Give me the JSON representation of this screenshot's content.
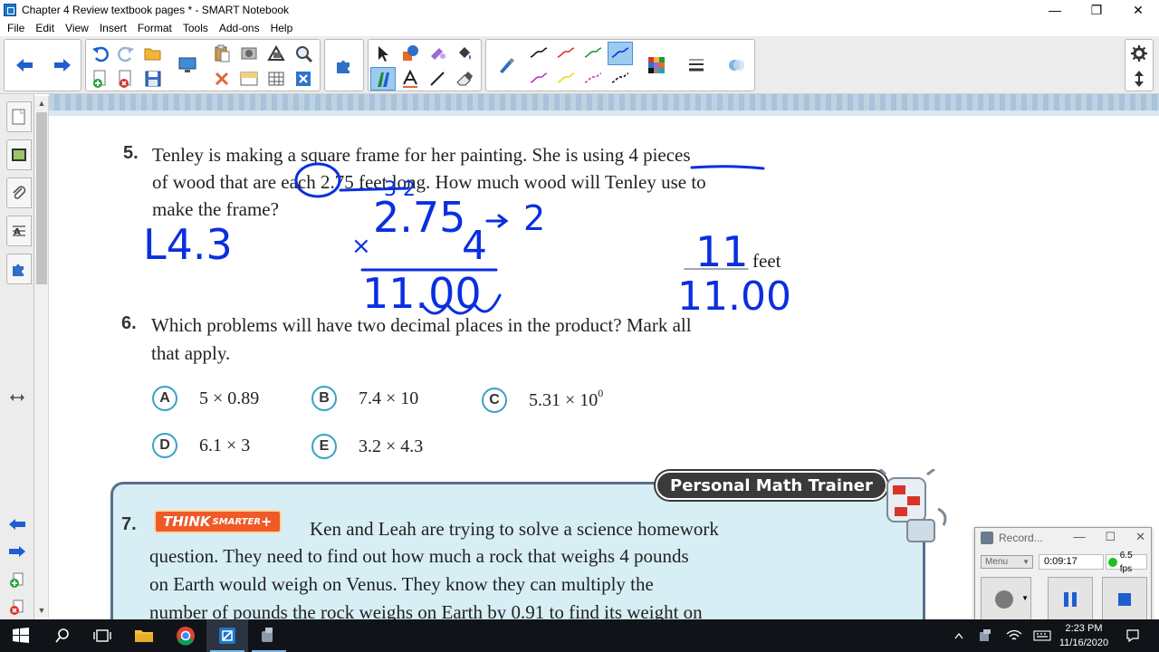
{
  "window": {
    "title": "Chapter 4 Review textbook pages * - SMART Notebook",
    "minimize": "—",
    "maximize": "❐",
    "close": "✕"
  },
  "menu": [
    "File",
    "Edit",
    "View",
    "Insert",
    "Format",
    "Tools",
    "Add-ons",
    "Help"
  ],
  "colors": {
    "accent_blue": "#1e5fcf",
    "ink_blue": "#0a2fe0",
    "bubble_teal": "#36a2c6",
    "q7_bg": "#d7eef5",
    "think_orange": "#f05a28",
    "rec_green": "#1fc01f"
  },
  "page": {
    "q5": {
      "number": "5.",
      "lines": [
        "Tenley is making a square frame for her painting. She is using 4 pieces",
        "of wood that are each 2.75 feet long. How much wood will Tenley use to",
        "make the frame?"
      ],
      "answer_unit": "feet"
    },
    "q6": {
      "number": "6.",
      "lines": [
        "Which problems will have two decimal places in the product? Mark all",
        "that apply."
      ],
      "choices": [
        {
          "letter": "A",
          "text": "5 × 0.89"
        },
        {
          "letter": "B",
          "text": "7.4 × 10"
        },
        {
          "letter": "C",
          "text": "5.31 × 10",
          "sup": "0"
        },
        {
          "letter": "D",
          "text": "6.1 × 3"
        },
        {
          "letter": "E",
          "text": "3.2 × 4.3"
        }
      ]
    },
    "q7": {
      "number": "7.",
      "badge_think": "THINK",
      "badge_smarter": "SMARTER",
      "badge_plus": "+",
      "trainer_label": "Personal Math Trainer",
      "lines": [
        "Ken and Leah are trying to solve a science homework",
        "question. They need to find out how much a rock that weighs 4 pounds",
        "on Earth would weigh on Venus. They know they can multiply the",
        "number of pounds the rock weighs on Earth by 0.91 to find its weight on"
      ]
    }
  },
  "ink": {
    "label": "L4.3",
    "carry": "3 2",
    "top": "2.75",
    "arrow_label": "2",
    "multiplier": "4",
    "times": "×",
    "product": "11.00",
    "answer_blank": "11",
    "answer_below": "11.00"
  },
  "recorder": {
    "title": "Record...",
    "minimize": "—",
    "maximize": "☐",
    "close": "✕",
    "menu_label": "Menu",
    "time": "0:09:17",
    "fps": "6.5 fps"
  },
  "taskbar": {
    "time": "2:23 PM",
    "date": "11/16/2020"
  }
}
